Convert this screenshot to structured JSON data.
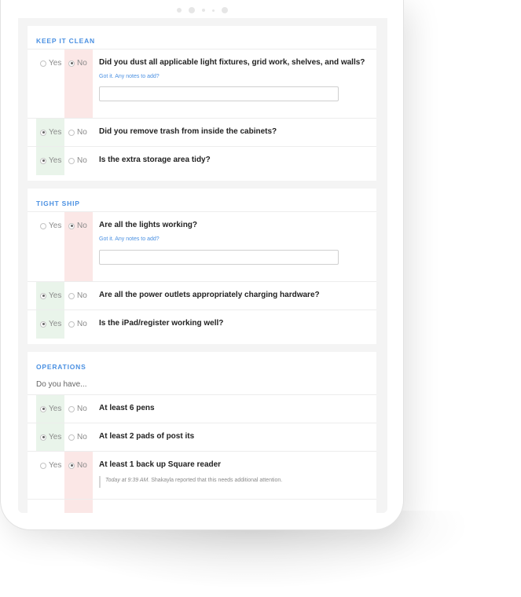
{
  "sections": [
    {
      "title": "KEEP IT CLEAN",
      "items": [
        {
          "question": "Did you dust all applicable light fixtures, grid work, shelves, and walls?",
          "answer": "No",
          "hint": "Got it. Any notes to add?"
        },
        {
          "question": "Did you remove trash from inside the cabinets?",
          "answer": "Yes"
        },
        {
          "question": "Is the extra storage area tidy?",
          "answer": "Yes"
        }
      ]
    },
    {
      "title": "TIGHT SHIP",
      "items": [
        {
          "question": "Are all the lights working?",
          "answer": "No",
          "hint": "Got it. Any notes to add?"
        },
        {
          "question": "Are all the power outlets appropriately charging hardware?",
          "answer": "Yes"
        },
        {
          "question": "Is the iPad/register working well?",
          "answer": "Yes"
        }
      ]
    },
    {
      "title": "OPERATIONS",
      "subtitle": "Do you have...",
      "items": [
        {
          "question": "At least 6 pens",
          "answer": "Yes"
        },
        {
          "question": "At least 2 pads of post its",
          "answer": "Yes"
        },
        {
          "question": "At least 1 back up Square reader",
          "answer": "No",
          "comment_time": "Today at 9:39 AM.",
          "comment_text": " Shakayla reported that this needs additional attention."
        }
      ]
    }
  ],
  "labels": {
    "yes": "Yes",
    "no": "No"
  },
  "colors": {
    "accent": "#4a90e2",
    "yes_bg": "#e9f4ea",
    "no_bg": "#fbe7e6"
  }
}
